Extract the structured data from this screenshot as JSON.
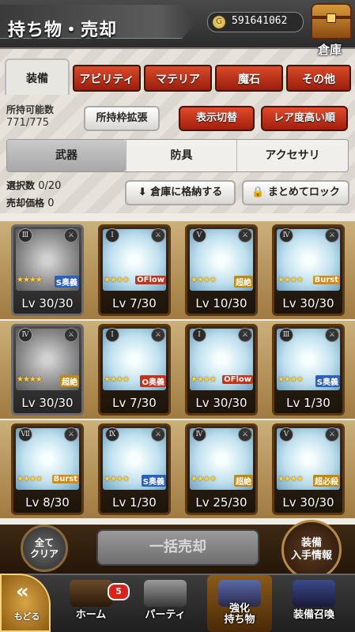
{
  "header": {
    "title": "持ち物・売却",
    "gil": "591641062",
    "storage_label": "倉庫"
  },
  "tabs": [
    {
      "label": "装備",
      "active": true
    },
    {
      "label": "アビリティ"
    },
    {
      "label": "マテリア"
    },
    {
      "label": "魔石"
    },
    {
      "label": "その他"
    }
  ],
  "info": {
    "capacity_label": "所持可能数",
    "capacity_value": "771/775",
    "expand_button": "所持枠拡張",
    "toggle_button": "表示切替",
    "sort_button": "レア度高い順"
  },
  "subtabs": [
    {
      "label": "武器",
      "active": true
    },
    {
      "label": "防具"
    },
    {
      "label": "アクセサリ"
    }
  ],
  "selection": {
    "count_label": "選択数",
    "count_value": "0/20",
    "price_label": "売却価格",
    "price_value": "0",
    "store_button": "倉庫に格納する",
    "lock_button": "まとめてロック"
  },
  "items": [
    {
      "rank": "Ⅲ",
      "stars": "★★★★",
      "badge": "S奥義",
      "badge_type": "s",
      "level": "Lv 30/30",
      "locked": true
    },
    {
      "rank": "Ⅰ",
      "stars": "★★★★",
      "badge": "OFlow",
      "badge_type": "o",
      "level": "Lv 7/30"
    },
    {
      "rank": "Ⅴ",
      "stars": "★★★★",
      "badge": "超絶",
      "badge_type": "u",
      "level": "Lv 10/30"
    },
    {
      "rank": "Ⅳ",
      "stars": "★★★★",
      "badge": "Burst",
      "badge_type": "b",
      "level": "Lv 30/30"
    },
    {
      "rank": "Ⅳ",
      "stars": "★★★★",
      "badge": "超絶",
      "badge_type": "u",
      "level": "Lv 30/30",
      "locked": true
    },
    {
      "rank": "Ⅰ",
      "stars": "★★★★",
      "badge": "O奥義",
      "badge_type": "o",
      "level": "Lv 7/30"
    },
    {
      "rank": "Ⅰ",
      "stars": "★★★★",
      "badge": "OFlow",
      "badge_type": "o",
      "level": "Lv 30/30"
    },
    {
      "rank": "Ⅲ",
      "stars": "★★★★",
      "badge": "S奥義",
      "badge_type": "s",
      "level": "Lv 1/30"
    },
    {
      "rank": "Ⅶ",
      "stars": "★★★★",
      "badge": "Burst",
      "badge_type": "b",
      "level": "Lv 8/30"
    },
    {
      "rank": "Ⅸ",
      "stars": "★★★★",
      "badge": "S奥義",
      "badge_type": "s",
      "level": "Lv 1/30"
    },
    {
      "rank": "Ⅳ",
      "stars": "★★★★",
      "badge": "超絶",
      "badge_type": "u",
      "level": "Lv 25/30"
    },
    {
      "rank": "Ⅴ",
      "stars": "★★★★",
      "badge": "超必殺",
      "badge_type": "u",
      "level": "Lv 30/30"
    }
  ],
  "actions": {
    "select_all": "全て\nクリア",
    "sell_all": "一括売却",
    "equip_info": "装備\n入手情報"
  },
  "nav": {
    "back": "もどる",
    "items": [
      {
        "label": "ホーム",
        "badge": "5"
      },
      {
        "label": "パーティ"
      },
      {
        "label": "強化\n持ち物",
        "active": true
      },
      {
        "label": "装備召喚"
      }
    ]
  }
}
